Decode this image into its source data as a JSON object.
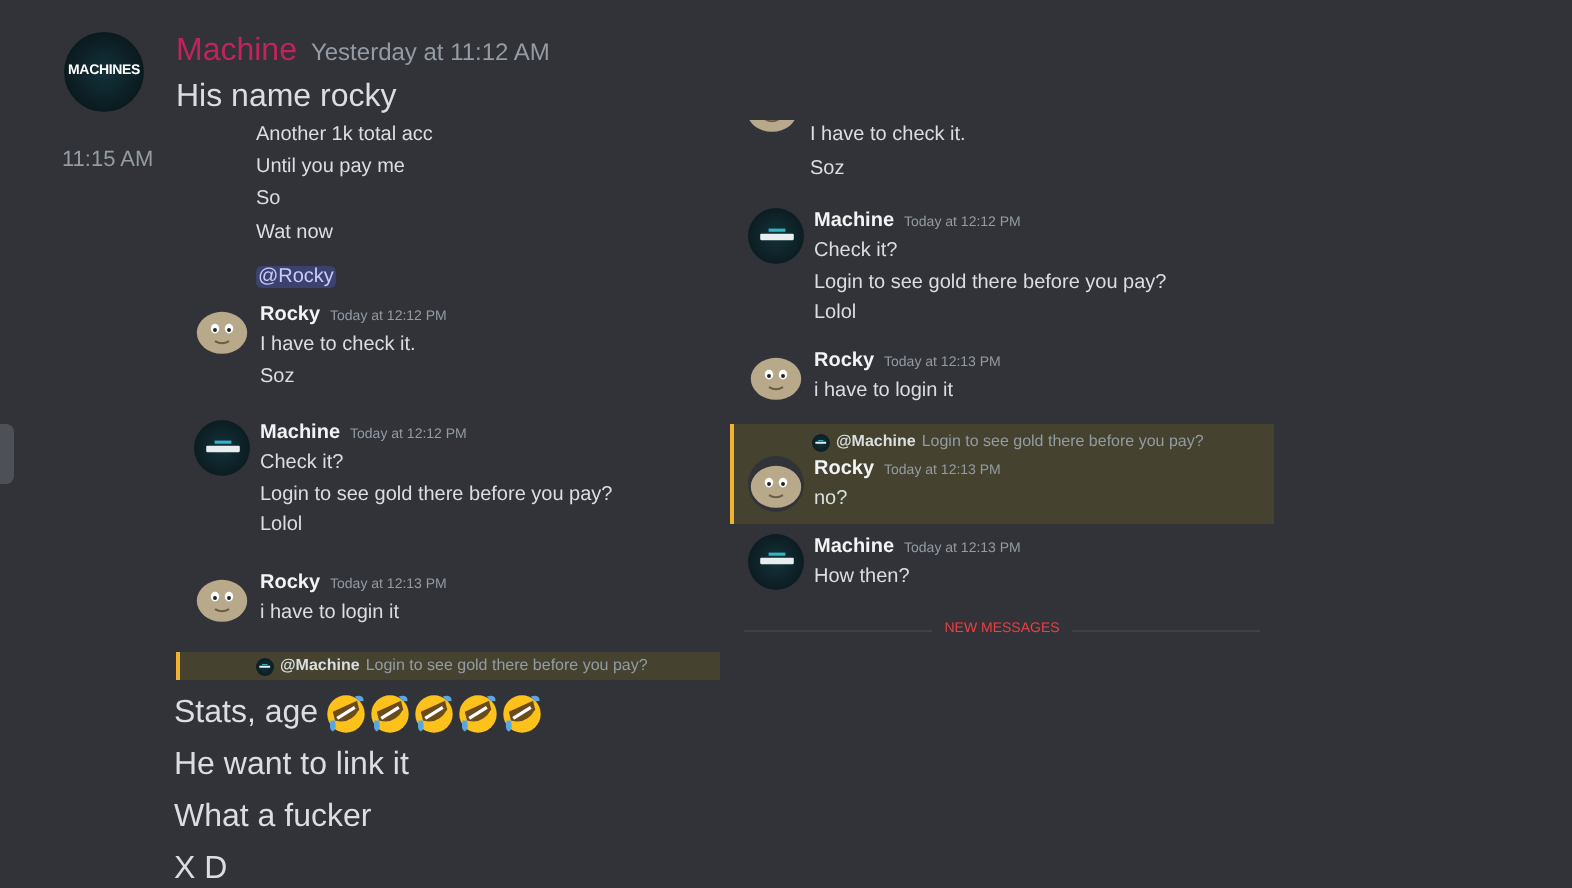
{
  "message": {
    "author": "Machine",
    "timestamp": "Yesterday at 11:12 AM",
    "text": "His name rocky",
    "avatar_label": "MACHINES"
  },
  "follow_up_time": "11:15 AM",
  "screenshots": [
    {
      "items": [
        {
          "kind": "line",
          "text": "Another 1k total acc"
        },
        {
          "kind": "line",
          "text": "Until you pay me"
        },
        {
          "kind": "line",
          "text": "So"
        },
        {
          "kind": "line",
          "text": "Wat now"
        },
        {
          "kind": "mention",
          "text": "@Rocky"
        },
        {
          "kind": "message",
          "avatar": {
            "kind": "rock"
          },
          "author": "Rocky",
          "time": "Today at 12:12 PM",
          "lines": [
            "I have to check it.",
            "Soz"
          ],
          "highlighted": false
        },
        {
          "kind": "message",
          "avatar": {
            "kind": "machine"
          },
          "author": "Machine",
          "time": "Today at 12:12 PM",
          "lines": [
            "Check it?",
            "Login to see gold there before you pay?",
            "Lolol"
          ],
          "highlighted": false
        },
        {
          "kind": "message",
          "avatar": {
            "kind": "rock"
          },
          "author": "Rocky",
          "time": "Today at 12:13 PM",
          "lines": [
            "i have to login it"
          ],
          "highlighted": false
        },
        {
          "kind": "reply_strip",
          "mention": "@Machine",
          "text": "Login to see gold there before you pay?",
          "highlighted": true
        }
      ]
    },
    {
      "items": [
        {
          "kind": "tail",
          "avatar": {
            "kind": "rock"
          },
          "lines": [
            "I have to check it.",
            "Soz"
          ]
        },
        {
          "kind": "message",
          "avatar": {
            "kind": "machine"
          },
          "author": "Machine",
          "time": "Today at 12:12 PM",
          "lines": [
            "Check it?",
            "Login to see gold there before you pay?",
            "Lolol"
          ],
          "highlighted": false
        },
        {
          "kind": "message",
          "avatar": {
            "kind": "rock"
          },
          "author": "Rocky",
          "time": "Today at 12:13 PM",
          "lines": [
            "i have to login it"
          ],
          "highlighted": false
        },
        {
          "kind": "message",
          "avatar": {
            "kind": "rock"
          },
          "author": "Rocky",
          "time": "Today at 12:13 PM",
          "lines": [
            "no?"
          ],
          "highlighted": true,
          "reply_to": {
            "mention": "@Machine",
            "text": "Login to see gold there before you pay?"
          }
        },
        {
          "kind": "message",
          "avatar": {
            "kind": "machine"
          },
          "author": "Machine",
          "time": "Today at 12:13 PM",
          "lines": [
            "How then?"
          ],
          "highlighted": false
        },
        {
          "kind": "divider",
          "text": "NEW MESSAGES"
        }
      ]
    }
  ],
  "lines": [
    {
      "text": "Stats, age",
      "emojis": [
        {
          "kind": "rofl"
        },
        {
          "kind": "rofl"
        },
        {
          "kind": "rofl"
        },
        {
          "kind": "rofl"
        },
        {
          "kind": "rofl"
        }
      ]
    },
    {
      "text": "He want to link it"
    },
    {
      "text": "What a fucker"
    },
    {
      "text": "X D"
    }
  ]
}
